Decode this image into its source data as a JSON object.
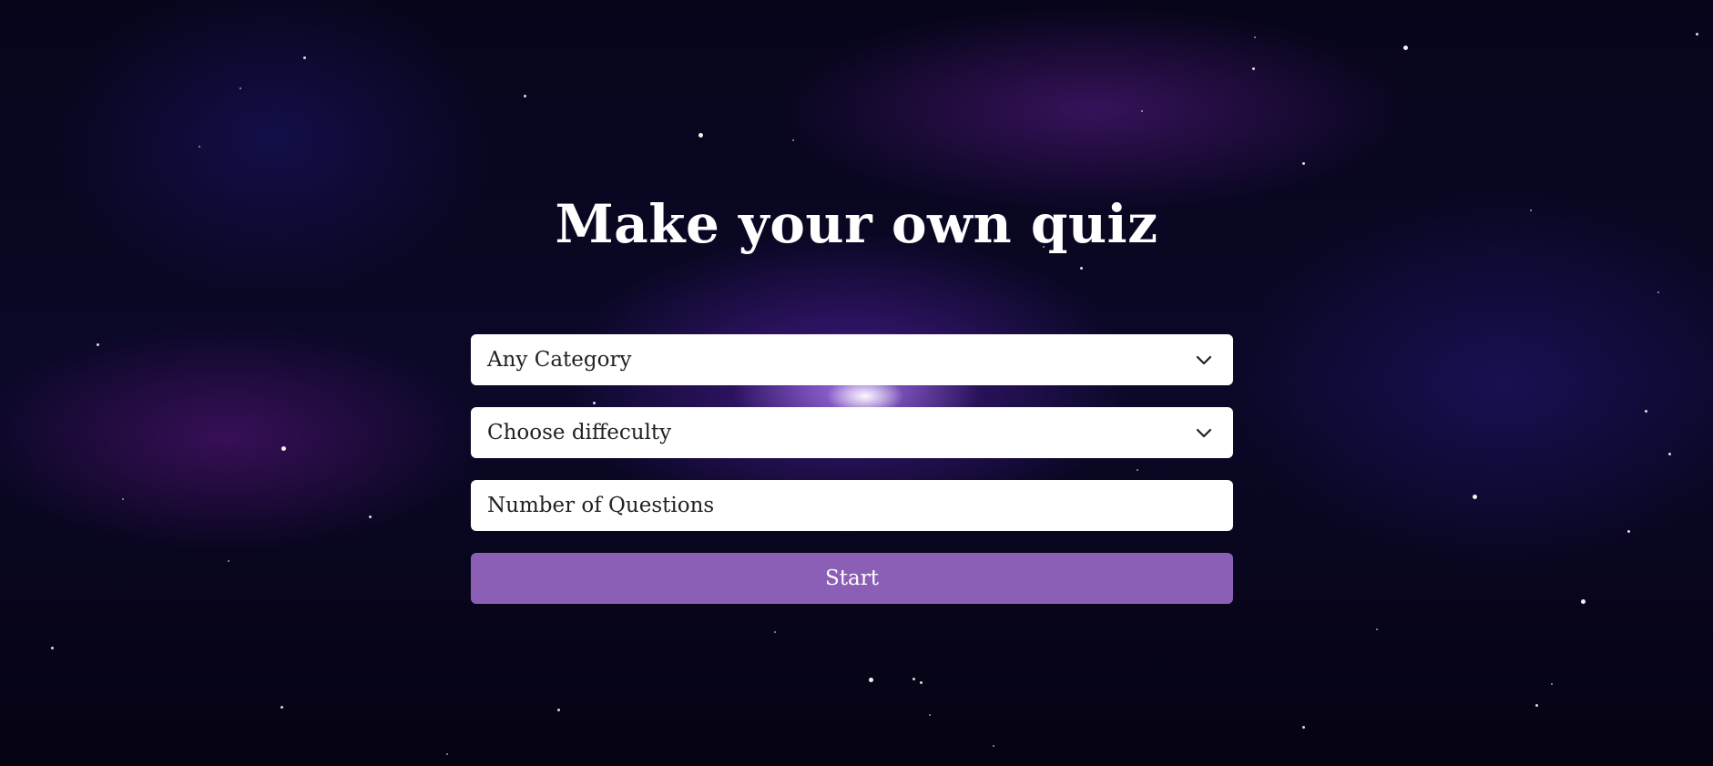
{
  "page": {
    "title": "Make your own quiz"
  },
  "form": {
    "category_select": {
      "selected": "Any Category",
      "icon": "chevron-down-icon"
    },
    "difficulty_select": {
      "selected": "Choose diffeculty",
      "icon": "chevron-down-icon"
    },
    "questions_input": {
      "placeholder": "Number of Questions"
    },
    "start_button": {
      "label": "Start"
    }
  },
  "colors": {
    "background": "#0b0828",
    "title_text": "#ffffff",
    "field_background": "#ffffff",
    "field_text": "#222222",
    "button_accent": "#8b5fb5",
    "button_text": "#ffffff"
  }
}
